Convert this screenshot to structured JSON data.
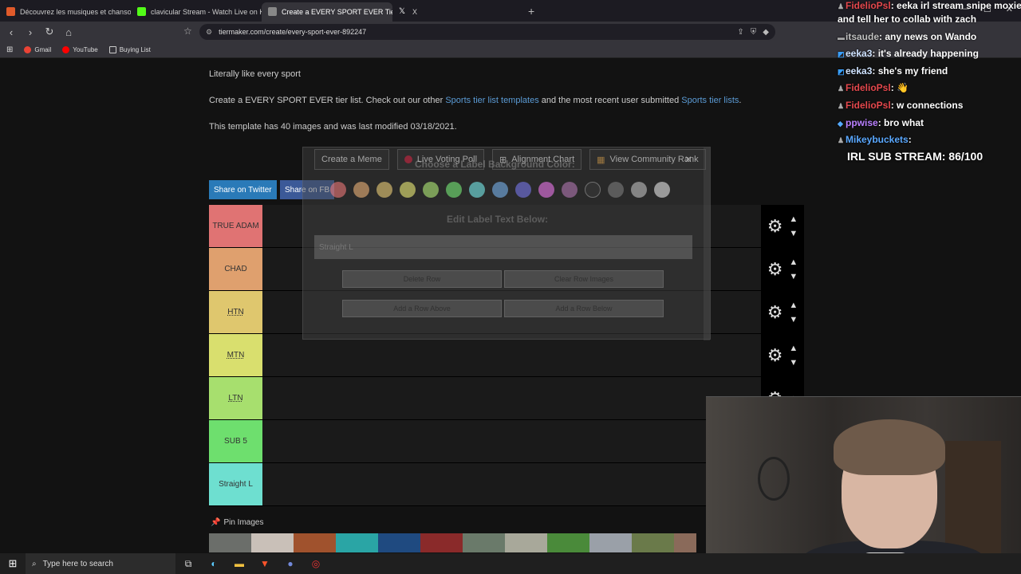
{
  "tabs": [
    {
      "title": "Découvrez les musiques et chansons",
      "color": "#e05a2a",
      "active": false
    },
    {
      "title": "clavicular Stream - Watch Live on Kick",
      "color": "#53fc18",
      "active": false
    },
    {
      "title": "Create a EVERY SPORT EVER Tier",
      "color": "#888888",
      "active": true
    },
    {
      "title": "X",
      "color": "#ffffff",
      "active": false
    }
  ],
  "url": "tiermaker.com/create/every-sport-ever-892247",
  "bookmarks": [
    {
      "label": "Gmail",
      "color": "#ea4335"
    },
    {
      "label": "YouTube",
      "color": "#ff0000"
    },
    {
      "label": "Buying List",
      "color": "#cccccc"
    }
  ],
  "intro": {
    "line1": "Literally like every sport",
    "line2_pre": "Create a EVERY SPORT EVER tier list. Check out our other ",
    "line2_link1": "Sports tier list templates",
    "line2_mid": " and the most recent user submitted ",
    "line2_link2": "Sports tier lists",
    "line2_post": ".",
    "line3": "This template has 40 images and was last modified 03/18/2021."
  },
  "buttons": {
    "meme": "Create a Meme",
    "poll": "Live Voting Poll",
    "alignment": "Alignment Chart",
    "community": "View Community Rank",
    "twitter": "Share on Twitter",
    "fb": "Share on FB"
  },
  "tiers": [
    {
      "label": "TRUE ADAM",
      "color": "#e07373",
      "underline": false
    },
    {
      "label": "CHAD",
      "color": "#dfa06e",
      "underline": false
    },
    {
      "label": "HTN",
      "color": "#dfc76e",
      "underline": true
    },
    {
      "label": "MTN",
      "color": "#d9df6e",
      "underline": true
    },
    {
      "label": "LTN",
      "color": "#a7df6e",
      "underline": true
    },
    {
      "label": "SUB 5",
      "color": "#6edf6e",
      "underline": false
    },
    {
      "label": "Straight L",
      "color": "#6edfd0",
      "underline": false
    }
  ],
  "pin_label": "Pin Images",
  "modal": {
    "title": "Choose a Label Background Color:",
    "subtitle": "Edit Label Text Below:",
    "input_value": "Straight L",
    "delete": "Delete Row",
    "clear": "Clear Row Images",
    "add_above": "Add a Row Above",
    "add_below": "Add a Row Below",
    "swatches": [
      "#ff7f7f",
      "#ffbf7f",
      "#ffdf7f",
      "#ffff7f",
      "#bfff7f",
      "#7fff7f",
      "#7fffff",
      "#7fbfff",
      "#7f7fff",
      "#ff7fff",
      "#bf7fbf",
      "#3b3b3b",
      "#858585",
      "#cfcfcf",
      "#f7f7f7"
    ]
  },
  "chat": [
    {
      "user": "FidelioPsl",
      "color": "#e5484d",
      "text": ": eeka irl stream snipe moxie"
    },
    {
      "user": "",
      "color": "#ffffff",
      "text": "and tell her to collab with zach"
    },
    {
      "user": "itsaude",
      "color": "#c0c0c0",
      "text": ": any news on Wando"
    },
    {
      "user": "eeka3",
      "color": "#cfe3ff",
      "text": ": it's already happening"
    },
    {
      "user": "eeka3",
      "color": "#cfe3ff",
      "text": ": she's my friend"
    },
    {
      "user": "FidelioPsl",
      "color": "#e5484d",
      "text": ": 👋"
    },
    {
      "user": "FidelioPsl",
      "color": "#e5484d",
      "text": ": w connections"
    },
    {
      "user": "ppwise",
      "color": "#b980ff",
      "text": ": bro what"
    },
    {
      "user": "Mikeybuckets",
      "color": "#5aa8ff",
      "text": ":"
    }
  ],
  "sub_stream": "IRL SUB STREAM: 86/100",
  "taskbar": {
    "search_placeholder": "Type here to search"
  },
  "thumb_colors": [
    "#6b6e6a",
    "#b98a78",
    "#8c5a3a",
    "#2aa5a5",
    "#1f4a80",
    "#3c6aa0",
    "#7a2a2a",
    "#6a7a6a",
    "#8a8a7a",
    "#4a8a3a",
    "#9aa0a8",
    "#5a6aa0",
    "#6a7a4a"
  ]
}
